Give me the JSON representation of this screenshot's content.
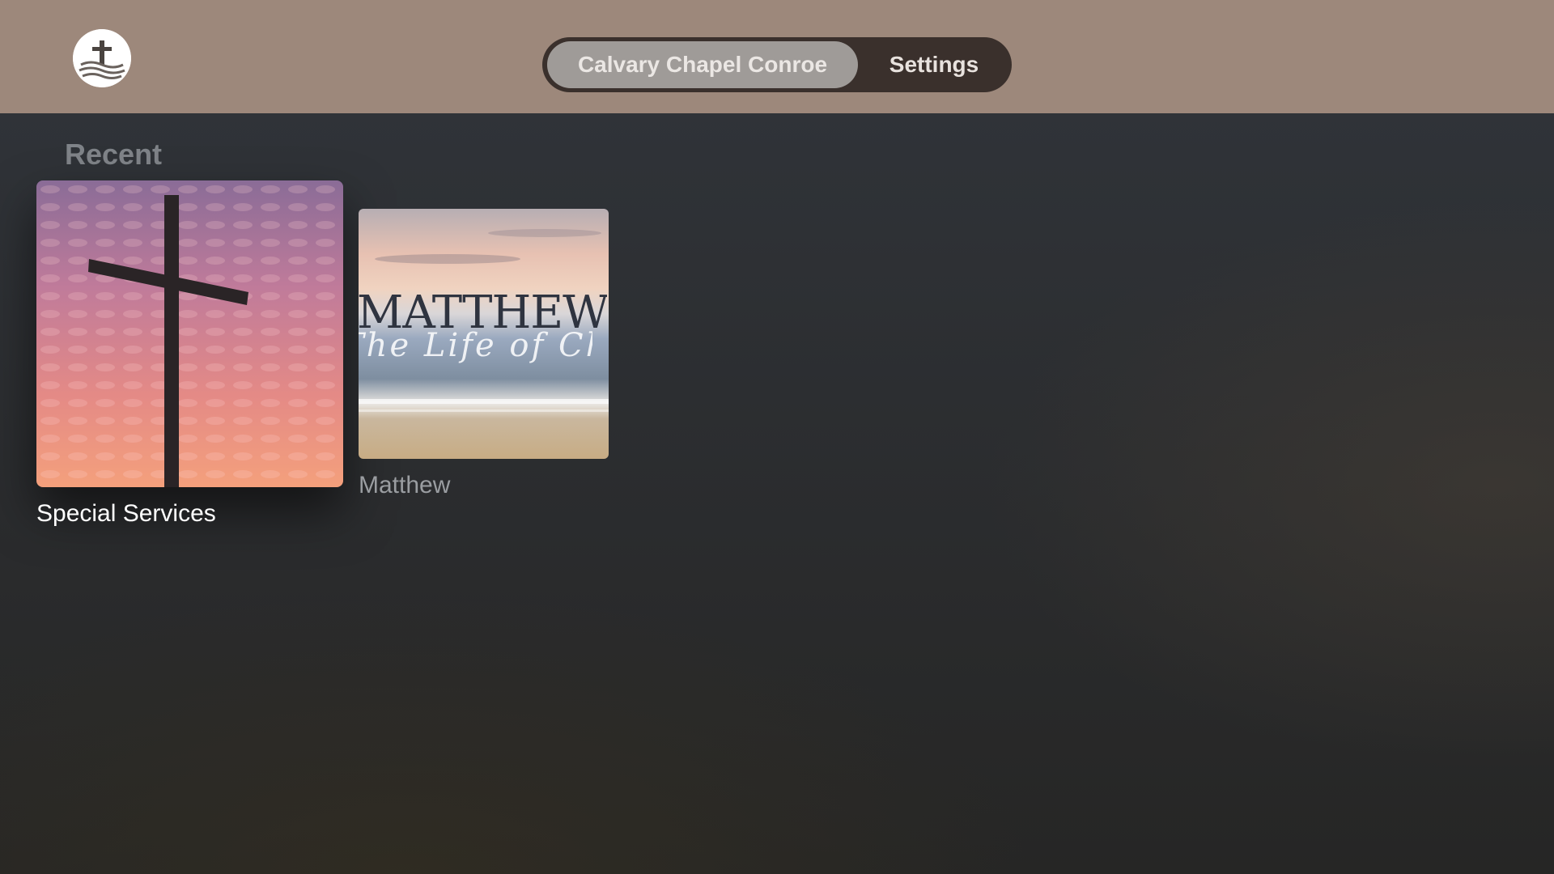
{
  "app": {
    "logo_icon": "cross-logo-icon"
  },
  "nav": {
    "tabs": [
      {
        "label": "Calvary Chapel Conroe",
        "selected": true
      },
      {
        "label": "Settings",
        "selected": false
      }
    ]
  },
  "recent": {
    "title": "Recent",
    "items": [
      {
        "label": "Special Services",
        "focused": true,
        "artwork": "cross-sunset-artwork"
      },
      {
        "label": "Matthew",
        "focused": false,
        "artwork": "beach-artwork",
        "art_title": "MATTHEW",
        "art_subtitle": "The Life of Christ"
      }
    ]
  },
  "colors": {
    "header_bg": "#9d887b",
    "tab_bar_bg": "#3a302c",
    "selected_tab_bg": "#9f9b98"
  }
}
